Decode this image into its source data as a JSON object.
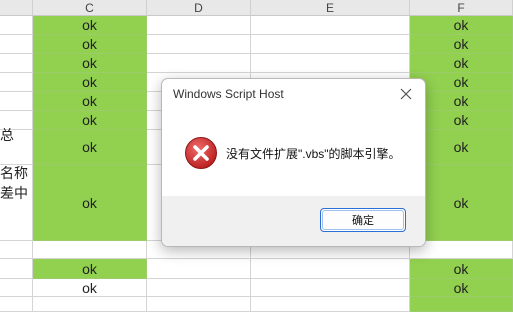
{
  "spreadsheet": {
    "columns": [
      "C",
      "D",
      "E",
      "F"
    ],
    "cell_value": "ok",
    "partial_text_fragments": [
      "总",
      "名称",
      "差中"
    ]
  },
  "dialog": {
    "title": "Windows Script Host",
    "message": "没有文件扩展\".vbs\"的脚本引擎。",
    "ok_label": "确定",
    "icon": "error-icon",
    "close_icon": "close-icon"
  },
  "colors": {
    "cell_green": "#92d050",
    "header_bg": "#e8e8e8",
    "error_red": "#d32f2f",
    "button_border": "#2a6fd6"
  }
}
